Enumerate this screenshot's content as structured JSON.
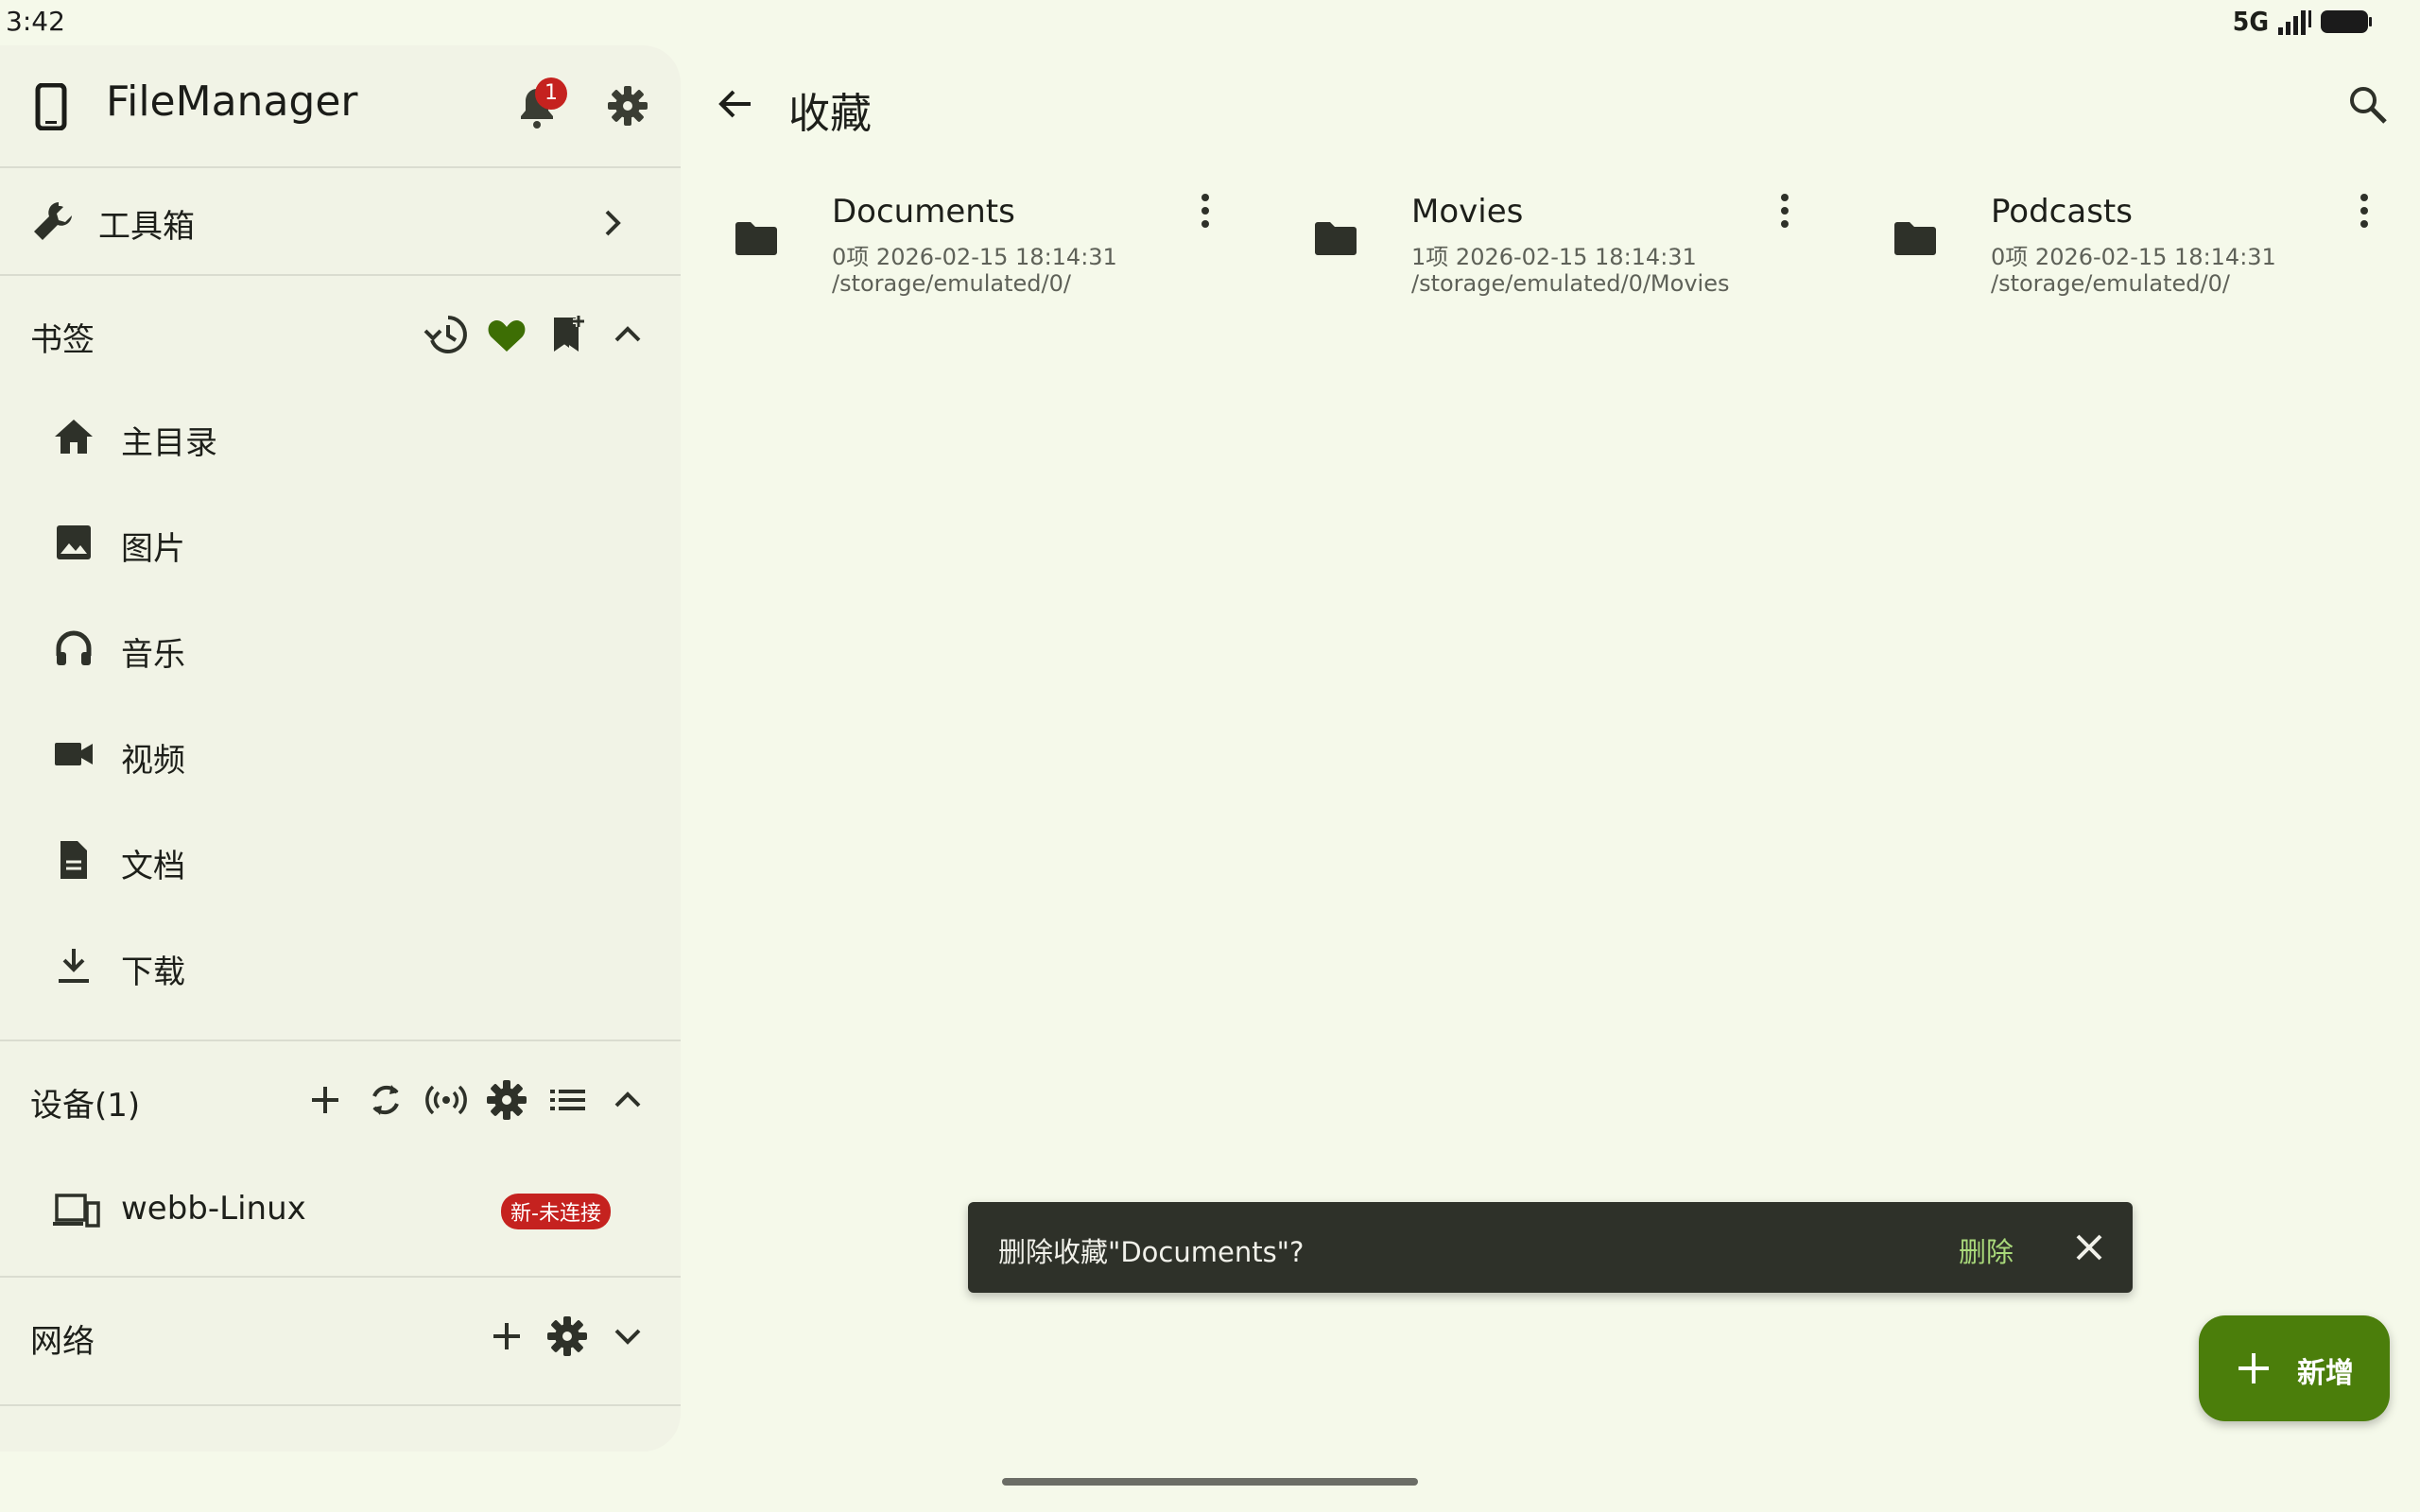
{
  "status_bar": {
    "time": "3:42",
    "network": "5G"
  },
  "sidebar": {
    "app_title": "FileManager",
    "notification_count": "1",
    "toolbox_label": "工具箱",
    "bookmarks": {
      "header": "书签",
      "items": [
        {
          "label": "主目录",
          "icon": "home-icon"
        },
        {
          "label": "图片",
          "icon": "image-icon"
        },
        {
          "label": "音乐",
          "icon": "headphones-icon"
        },
        {
          "label": "视频",
          "icon": "video-icon"
        },
        {
          "label": "文档",
          "icon": "document-icon"
        },
        {
          "label": "下载",
          "icon": "download-icon"
        }
      ]
    },
    "devices": {
      "header": "设备(1)",
      "items": [
        {
          "label": "webb-Linux",
          "tag": "新-未连接"
        }
      ]
    },
    "network_header": "网络"
  },
  "main": {
    "title": "收藏",
    "favorites": [
      {
        "name": "Documents",
        "count": "0项",
        "date": "2026-02-15 18:14:31",
        "path": "/storage/emulated/0/"
      },
      {
        "name": "Movies",
        "count": "1项",
        "date": "2026-02-15 18:14:31",
        "path": "/storage/emulated/0/Movies"
      },
      {
        "name": "Podcasts",
        "count": "0项",
        "date": "2026-02-15 18:14:31",
        "path": "/storage/emulated/0/"
      }
    ]
  },
  "snackbar": {
    "message": "删除收藏\"Documents\"?",
    "action": "删除"
  },
  "fab": {
    "label": "新增"
  },
  "colors": {
    "accent": "#4b7e0b",
    "background": "#f5f9ea",
    "sidebar_bg": "#f1f3e6",
    "badge_red": "#c5221f",
    "snackbar_bg": "#2e3129"
  }
}
